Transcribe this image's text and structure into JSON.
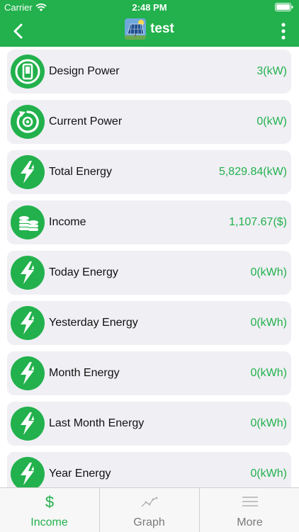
{
  "status_bar": {
    "carrier": "Carrier",
    "time": "2:48 PM"
  },
  "nav": {
    "title": "test",
    "back_icon": "chevron-left-icon",
    "more_icon": "vertical-ellipsis-icon"
  },
  "colors": {
    "brand": "#22b14c",
    "card_bg": "#efeff4",
    "value_text": "#22b14c"
  },
  "items": [
    {
      "label": "Design Power",
      "value": "3(kW)",
      "icon": "design-power-icon"
    },
    {
      "label": "Current Power",
      "value": "0(kW)",
      "icon": "current-power-icon"
    },
    {
      "label": "Total Energy",
      "value": "5,829.84(kW)",
      "icon": "energy-bolt-icon"
    },
    {
      "label": "Income",
      "value": "1,107.67($)",
      "icon": "coins-icon"
    },
    {
      "label": "Today Energy",
      "value": "0(kWh)",
      "icon": "energy-bolt-icon"
    },
    {
      "label": "Yesterday Energy",
      "value": "0(kWh)",
      "icon": "energy-bolt-icon"
    },
    {
      "label": "Month Energy",
      "value": "0(kWh)",
      "icon": "energy-bolt-icon"
    },
    {
      "label": "Last Month Energy",
      "value": "0(kWh)",
      "icon": "energy-bolt-icon"
    },
    {
      "label": "Year Energy",
      "value": "0(kWh)",
      "icon": "energy-bolt-icon"
    }
  ],
  "tabs": [
    {
      "label": "Income",
      "icon": "dollar-icon",
      "active": true
    },
    {
      "label": "Graph",
      "icon": "line-chart-icon",
      "active": false
    },
    {
      "label": "More",
      "icon": "hamburger-menu-icon",
      "active": false
    }
  ]
}
